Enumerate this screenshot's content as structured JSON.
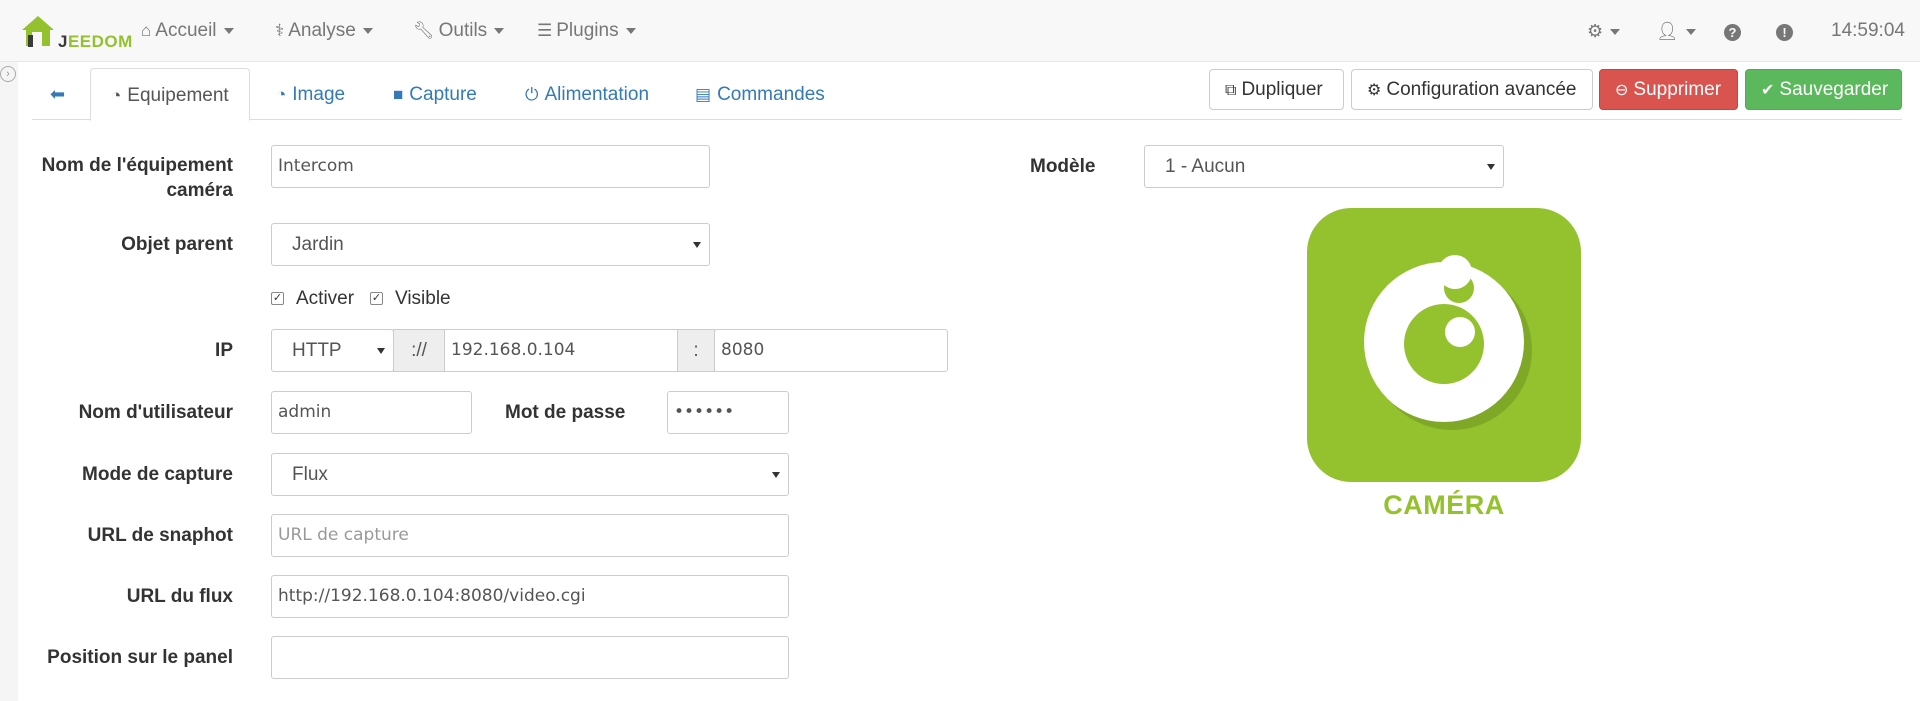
{
  "nav": {
    "logo": {
      "prefix": "J",
      "suffix": "EEDOM"
    },
    "items": [
      {
        "label": "Accueil",
        "icon": "home-icon"
      },
      {
        "label": "Analyse",
        "icon": "stethoscope-icon"
      },
      {
        "label": "Outils",
        "icon": "wrench-icon"
      },
      {
        "label": "Plugins",
        "icon": "list-icon"
      }
    ],
    "time": "14:59:04"
  },
  "tabs": [
    {
      "label": "Equipement",
      "icon": "tachometer-icon",
      "active": true
    },
    {
      "label": "Image",
      "icon": "tachometer-icon"
    },
    {
      "label": "Capture",
      "icon": "video-camera-icon"
    },
    {
      "label": "Alimentation",
      "icon": "power-icon"
    },
    {
      "label": "Commandes",
      "icon": "list-alt-icon"
    }
  ],
  "actions": {
    "duplicate": "Dupliquer",
    "advanced": "Configuration avancée",
    "delete": "Supprimer",
    "save": "Sauvegarder"
  },
  "colors": {
    "brand_green": "#94c12e",
    "danger": "#d9534f",
    "success": "#5cb85c",
    "link": "#337ab7"
  },
  "form": {
    "name_label_1": "Nom de l'équipement",
    "name_label_2": "caméra",
    "name_value": "Intercom",
    "parent_label": "Objet parent",
    "parent_value": "Jardin",
    "activate_label": "Activer",
    "visible_label": "Visible",
    "ip_label": "IP",
    "protocol_value": "HTTP",
    "scheme_sep": "://",
    "ip_value": "192.168.0.104",
    "port_sep": ":",
    "port_value": "8080",
    "username_label": "Nom d'utilisateur",
    "username_value": "admin",
    "password_label": "Mot de passe",
    "password_value": "••••••",
    "capture_mode_label": "Mode de capture",
    "capture_mode_value": "Flux",
    "snapshot_label": "URL de snaphot",
    "snapshot_placeholder": "URL de capture",
    "stream_label": "URL du flux",
    "stream_value": "http://192.168.0.104:8080/video.cgi",
    "panel_label": "Position sur le panel",
    "panel_value": "",
    "model_label": "Modèle",
    "model_value": "1 - Aucun"
  },
  "plugin_image": {
    "caption": "CAMÉRA",
    "icon": "camera-plugin-icon"
  }
}
